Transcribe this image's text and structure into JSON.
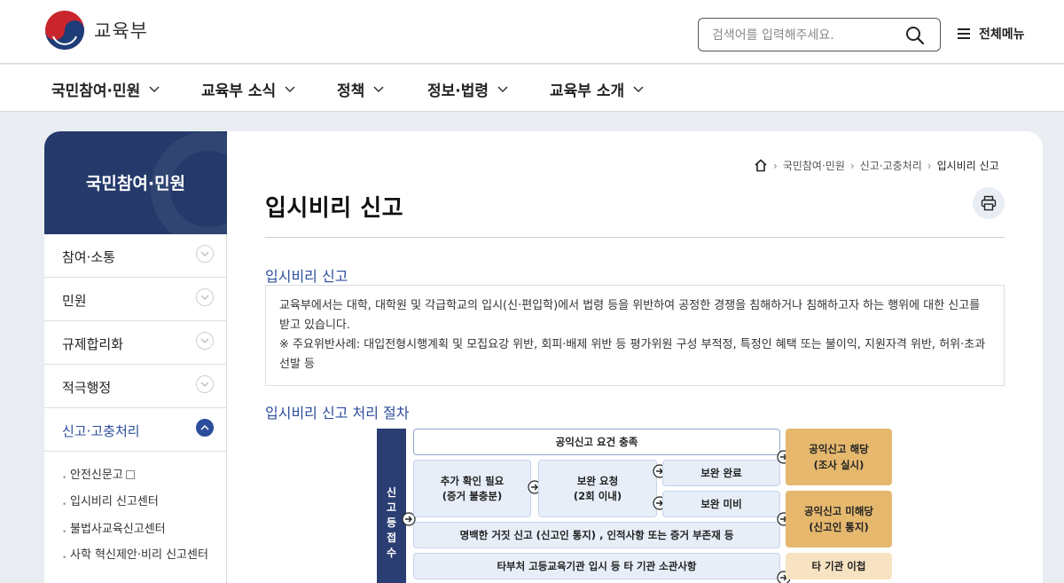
{
  "header": {
    "logo_text": "교육부",
    "search_placeholder": "검색어를 입력해주세요.",
    "all_menu_label": "전체메뉴"
  },
  "gnb": [
    "국민참여·민원",
    "교육부 소식",
    "정책",
    "정보·법령",
    "교육부 소개"
  ],
  "sidebar": {
    "title": "국민참여·민원",
    "items": [
      "참여·소통",
      "민원",
      "규제합리화",
      "적극행정",
      "신고·고충처리"
    ],
    "active_index": 4,
    "sub_items": [
      "안전신문고",
      "입시비리 신고센터",
      "불법사교육신고센터",
      "사학 혁신제안·비리 신고센터"
    ]
  },
  "breadcrumb": [
    "국민참여·민원",
    "신고·고충처리",
    "입시비리 신고"
  ],
  "page": {
    "title": "입시비리 신고",
    "section1_title": "입시비리 신고",
    "info_line1": "교육부에서는 대학, 대학원 및 각급학교의 입시(신·편입학)에서 법령 등을 위반하여 공정한 경쟁을 침해하거나 침해하고자 하는 행위에 대한 신고를 받고 있습니다.",
    "info_line2": "※ 주요위반사례: 대입전형시행계획 및 모집요강 위반, 회피·배제 위반 등 평가위원 구성 부적정, 특정인 혜택 또는 불이익, 지원자격 위반, 허위·초과 선발 등",
    "section2_title": "입시비리 신고 처리 절차"
  },
  "diagram": {
    "receive": "신고등접수",
    "receive_chars": [
      "신",
      "고",
      "등",
      "접",
      "수"
    ],
    "req_met": "공익신고 요건 충족",
    "need_check_1": "추가 확인 필요",
    "need_check_2": "(증거 불충분)",
    "supp_req_1": "보완 요청",
    "supp_req_2": "(2회 이내)",
    "supp_done": "보완 완료",
    "supp_fail": "보완 미비",
    "false_report": "명백한 거짓 신고 (신고인 통지) , 인적사항 또는 증거 부존재 등",
    "other_agency": "타부처 고등교육기관 입시 등 타 기관 소관사항",
    "res_yes_1": "공익신고 해당",
    "res_yes_2": "(조사 실시)",
    "res_no_1": "공익신고 미해당",
    "res_no_2": "(신고인 통지)",
    "res_transfer": "타 기관 이첩"
  },
  "colors": {
    "navy": "#253a6b",
    "accent_blue": "#2c4d9c",
    "gold": "#e5b86e",
    "light_gold": "#f7e3c2"
  }
}
